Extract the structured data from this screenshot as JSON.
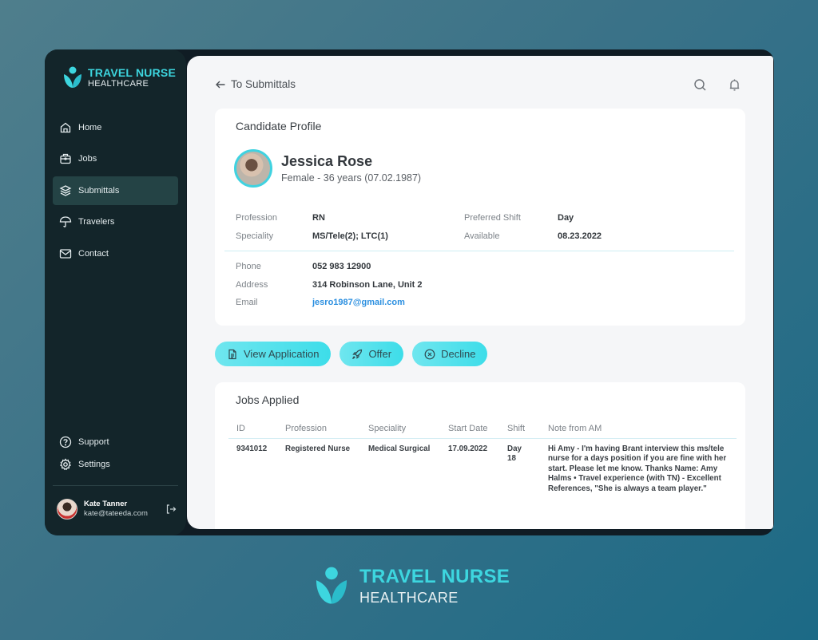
{
  "brand": {
    "title": "TRAVEL NURSE",
    "subtitle": "HEALTHCARE",
    "accent": "#3dd6df"
  },
  "sidebar": {
    "items": [
      {
        "label": "Home",
        "icon": "home-icon"
      },
      {
        "label": "Jobs",
        "icon": "briefcase-icon"
      },
      {
        "label": "Submittals",
        "icon": "layers-icon",
        "active": true
      },
      {
        "label": "Travelers",
        "icon": "umbrella-icon"
      },
      {
        "label": "Contact",
        "icon": "mail-icon"
      }
    ],
    "bottom_items": [
      {
        "label": "Support",
        "icon": "help-circle-icon"
      },
      {
        "label": "Settings",
        "icon": "gear-icon"
      }
    ],
    "user": {
      "name": "Kate Tanner",
      "email": "kate@tateeda.com"
    }
  },
  "header": {
    "back_label": "To Submittals"
  },
  "profile": {
    "title": "Candidate Profile",
    "name": "Jessica Rose",
    "subtitle": "Female - 36 years (07.02.1987)",
    "fields": {
      "profession_label": "Profession",
      "profession": "RN",
      "speciality_label": "Speciality",
      "speciality": "MS/Tele(2); LTC(1)",
      "shift_label": "Preferred Shift",
      "shift": "Day",
      "available_label": "Available",
      "available": "08.23.2022",
      "phone_label": "Phone",
      "phone": "052 983 12900",
      "address_label": "Address",
      "address": "314 Robinson Lane, Unit 2",
      "email_label": "Email",
      "email": "jesro1987@gmail.com"
    }
  },
  "actions": {
    "view_application": "View Application",
    "offer": "Offer",
    "decline": "Decline"
  },
  "jobs": {
    "title": "Jobs Applied",
    "columns": [
      "ID",
      "Profession",
      "Speciality",
      "Start Date",
      "Shift",
      "Note from AM"
    ],
    "rows": [
      {
        "id": "9341012",
        "profession": "Registered Nurse",
        "speciality": "Medical Surgical",
        "start_date": "17.09.2022",
        "shift": "Day 18",
        "note": "Hi Amy - I'm having Brant interview this ms/tele nurse for a days position if you are fine with her start. Please let me know. Thanks Name: Amy Halms • Travel experience (with TN) - Excellent References, \"She is always a team player.\""
      }
    ]
  },
  "footer": {
    "title": "TRAVEL NURSE",
    "subtitle": "HEALTHCARE"
  }
}
